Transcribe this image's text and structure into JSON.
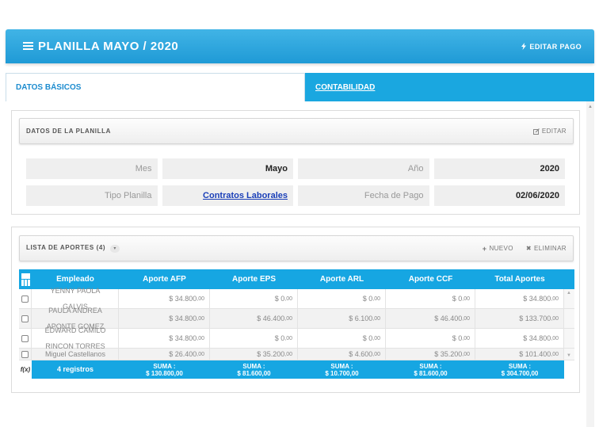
{
  "header": {
    "title": "PLANILLA MAYO / 2020",
    "edit_payment": "EDITAR PAGO"
  },
  "tabs": [
    {
      "label": "DATOS BÁSICOS",
      "active": true
    },
    {
      "label": "CONTABILIDAD",
      "active": false
    }
  ],
  "planilla_panel": {
    "title": "DATOS DE LA PLANILLA",
    "edit": "EDITAR",
    "fields": [
      [
        {
          "key": "Mes",
          "value": "Mayo"
        },
        {
          "key": "Año",
          "value": "2020"
        }
      ],
      [
        {
          "key": "Tipo Planilla",
          "value": "Contratos Laborales"
        },
        {
          "key": "Fecha de Pago",
          "value": "02/06/2020"
        }
      ]
    ]
  },
  "aportes_panel": {
    "title": "LISTA DE APORTES (4)",
    "new": "NUEVO",
    "delete": "ELIMINAR",
    "columns": [
      "Empleado",
      "Aporte AFP",
      "Aporte EPS",
      "Aporte ARL",
      "Aporte CCF",
      "Total Aportes"
    ],
    "rows": [
      {
        "employee": [
          "YENNY PAOLA",
          "GALVIS"
        ],
        "afp": "$ 34.800",
        "eps": "$ 0",
        "arl": "$ 0",
        "ccf": "$ 0",
        "total": "$ 34.800"
      },
      {
        "employee": [
          "PAULA ANDREA",
          "APONTE GOMEZ"
        ],
        "afp": "$ 34.800",
        "eps": "$ 46.400",
        "arl": "$ 6.100",
        "ccf": "$ 46.400",
        "total": "$ 133.700"
      },
      {
        "employee": [
          "EDWARD CAMILO",
          "RINCON TORRES"
        ],
        "afp": "$ 34.800",
        "eps": "$ 0",
        "arl": "$ 0",
        "ccf": "$ 0",
        "total": "$ 34.800"
      },
      {
        "employee": [
          "Miguel Castellanos"
        ],
        "afp": "$ 26.400",
        "eps": "$ 35.200",
        "arl": "$ 4.600",
        "ccf": "$ 35.200",
        "total": "$ 101.400"
      }
    ],
    "decimals": ",00",
    "footer": {
      "count": "4 registros",
      "sum_label": "SUMA :",
      "afp": "$ 130.800,00",
      "eps": "$ 81.600,00",
      "arl": "$ 10.700,00",
      "ccf": "$ 81.600,00",
      "total": "$ 304.700,00"
    }
  },
  "colors": {
    "accent": "#16a6e2",
    "link": "#1a3fb8"
  }
}
